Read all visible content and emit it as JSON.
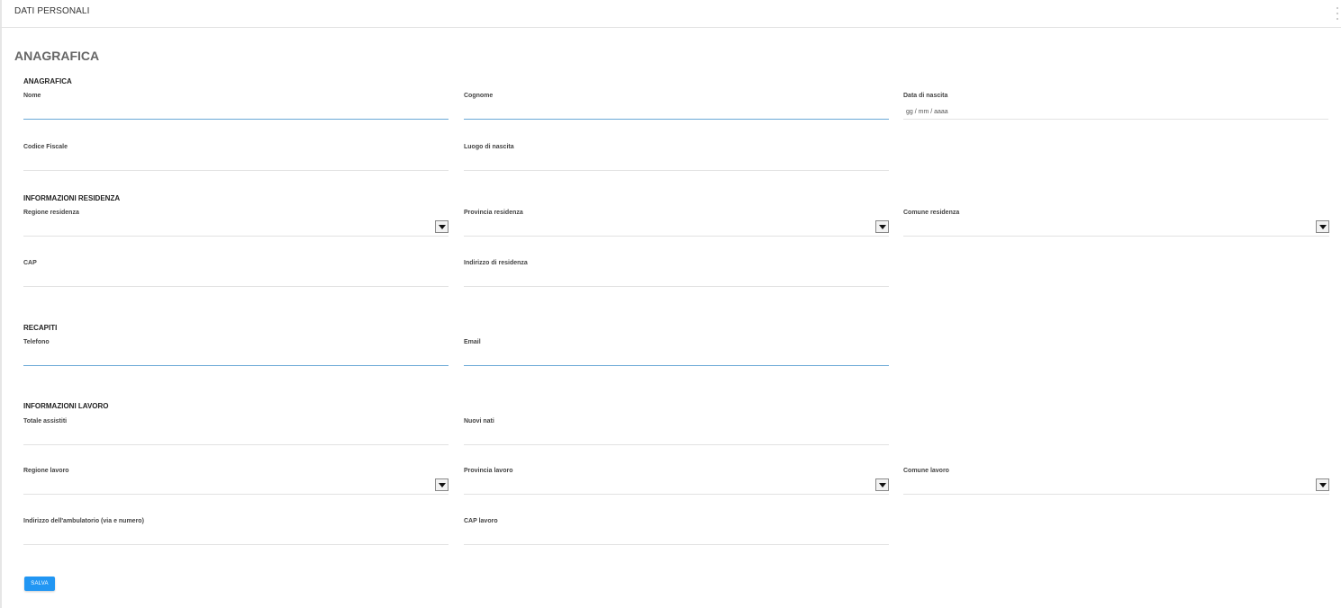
{
  "header": {
    "title": "DATI PERSONALI"
  },
  "page": {
    "title": "ANAGRAFICA"
  },
  "sections": {
    "anagrafica": "ANAGRAFICA",
    "residenza": "INFORMAZIONI RESIDENZA",
    "recapiti": "RECAPITI",
    "lavoro": "INFORMAZIONI LAVORO"
  },
  "fields": {
    "nome": "Nome",
    "cognome": "Cognome",
    "data_nascita": "Data di nascita",
    "data_nascita_placeholder": "gg / mm / aaaa",
    "codice_fiscale": "Codice Fiscale",
    "luogo_nascita": "Luogo di nascita",
    "regione_residenza": "Regione residenza",
    "provincia_residenza": "Provincia residenza",
    "comune_residenza": "Comune residenza",
    "cap": "CAP",
    "indirizzo_residenza": "Indirizzo di residenza",
    "telefono": "Telefono",
    "email": "Email",
    "totale_assistiti": "Totale assistiti",
    "nuovi_nati": "Nuovi nati",
    "regione_lavoro": "Regione lavoro",
    "provincia_lavoro": "Provincia lavoro",
    "comune_lavoro": "Comune lavoro",
    "indirizzo_ambulatorio": "Indirizzo dell'ambulatorio (via e numero)",
    "cap_lavoro": "CAP lavoro"
  },
  "actions": {
    "save": "SALVA"
  },
  "colors": {
    "primary": "#2196f3",
    "focus_line": "#6aa9d6"
  },
  "icons": {
    "menu": "more-vertical-icon",
    "select": "caret-down-icon"
  }
}
